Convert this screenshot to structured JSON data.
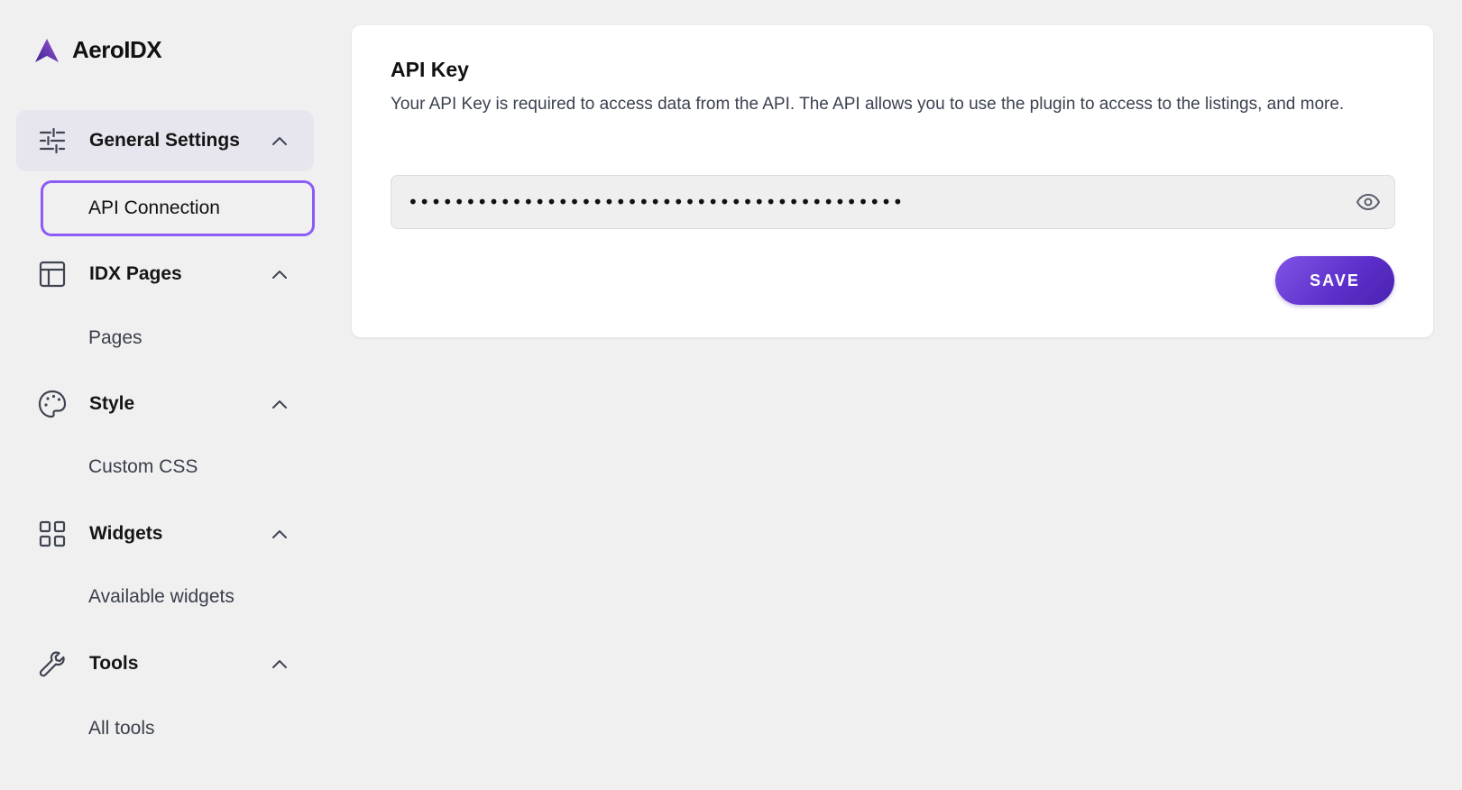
{
  "brand": {
    "name": "AeroIDX",
    "accent": "#6b3fd1"
  },
  "sidebar": {
    "groups": [
      {
        "label": "General Settings",
        "icon": "sliders-icon",
        "expanded": true,
        "active": true,
        "items": [
          {
            "label": "API Connection",
            "selected": true
          }
        ]
      },
      {
        "label": "IDX Pages",
        "icon": "layout-icon",
        "expanded": true,
        "items": [
          {
            "label": "Pages"
          }
        ]
      },
      {
        "label": "Style",
        "icon": "palette-icon",
        "expanded": true,
        "items": [
          {
            "label": "Custom CSS"
          }
        ]
      },
      {
        "label": "Widgets",
        "icon": "grid-icon",
        "expanded": true,
        "items": [
          {
            "label": "Available widgets"
          }
        ]
      },
      {
        "label": "Tools",
        "icon": "wrench-icon",
        "expanded": true,
        "items": [
          {
            "label": "All tools"
          }
        ]
      }
    ]
  },
  "main": {
    "card": {
      "title": "API Key",
      "description": "Your API Key is required to access data from the API. The API allows you to use the plugin to access to the listings, and more.",
      "api_key_masked": "•••••••••••••••••••••••••••••••••••••••••••",
      "visibility_icon": "eye-icon",
      "save_label": "SAVE"
    }
  },
  "colors": {
    "background": "#f0f0f0",
    "active_group_bg": "#e7e5ee",
    "selected_outline": "#8b5cf6",
    "save_button": "#5b2ec9"
  }
}
